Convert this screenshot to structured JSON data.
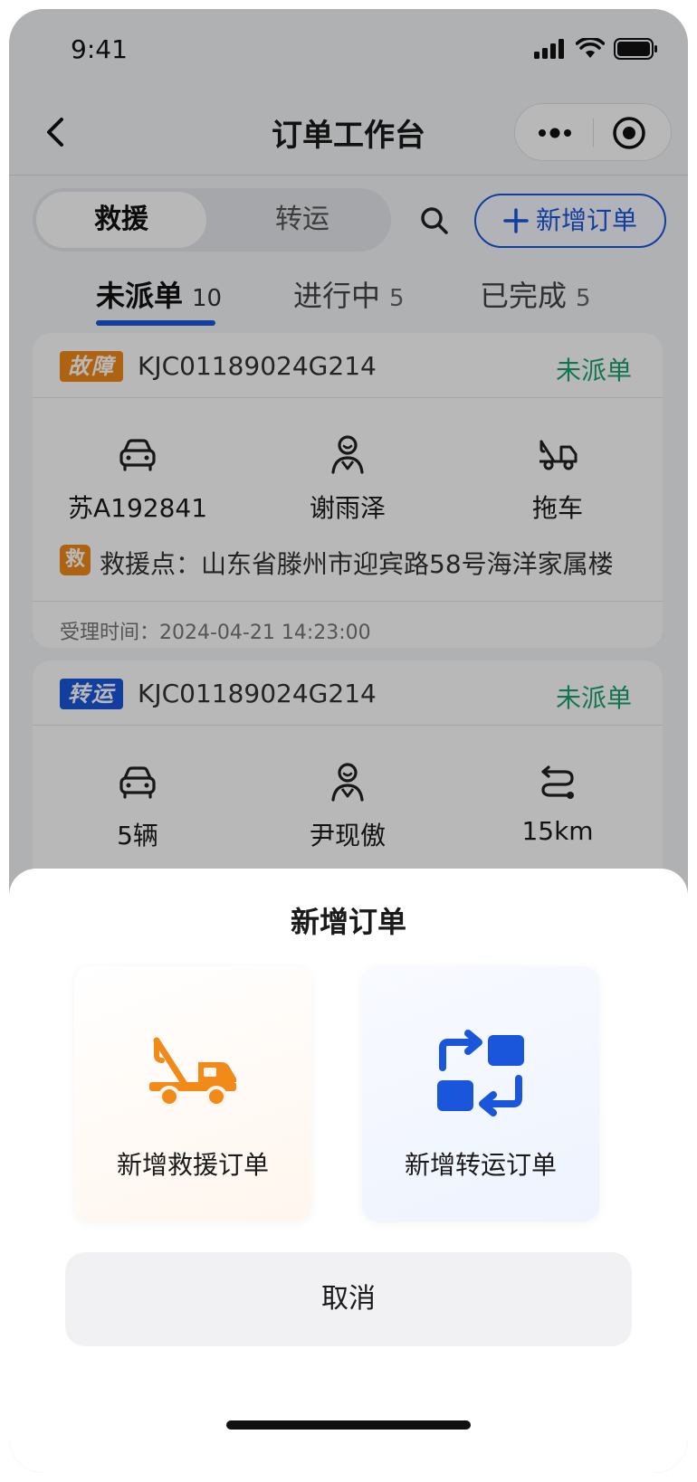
{
  "status_bar": {
    "time": "9:41"
  },
  "nav": {
    "title": "订单工作台"
  },
  "segments": [
    "救援",
    "转运"
  ],
  "add_order_label": "新增订单",
  "tabs": [
    {
      "label": "未派单",
      "count": "10"
    },
    {
      "label": "进行中",
      "count": "5"
    },
    {
      "label": "已完成",
      "count": "5"
    }
  ],
  "orders": [
    {
      "tag": "故障",
      "order_no": "KJC01189024G214",
      "status": "未派单",
      "plate": "苏A192841",
      "driver": "谢雨泽",
      "service": "拖车",
      "rescue_tag": "救",
      "rescue_point": "救援点：山东省滕州市迎宾路58号海洋家属楼",
      "accept_time": "受理时间：2024-04-21 14:23:00"
    },
    {
      "tag": "转运",
      "order_no": "KJC01189024G214",
      "status": "未派单",
      "vehicles": "5辆",
      "driver": "尹现傲",
      "distance": "15km"
    }
  ],
  "sheet": {
    "title": "新增订单",
    "rescue_option": "新增救援订单",
    "transfer_option": "新增转运订单",
    "cancel": "取消"
  },
  "colors": {
    "primary": "#1a56db",
    "fault_tag": "#f28a1a",
    "status_green": "#1aa36f"
  }
}
